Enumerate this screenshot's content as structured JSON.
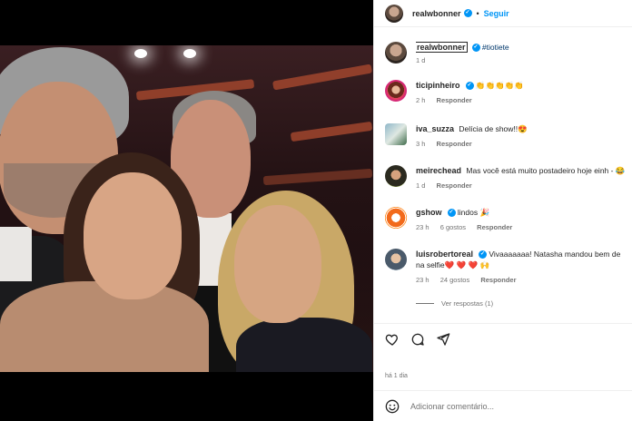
{
  "post": {
    "author": "realwbonner",
    "follow_label": "Seguir",
    "dot": "•",
    "caption": {
      "username": "realwbonner",
      "hashtag": "#tiotiete",
      "time": "1 d"
    },
    "photo_alt": "Selfie de quatro pessoas em estúdio de TV"
  },
  "comments": [
    {
      "username": "ticipinheiro",
      "verified": true,
      "text": "👏👏👏👏👏",
      "time": "2 h",
      "likes": "",
      "reply": "Responder",
      "avatar_icon": "tici-avatar"
    },
    {
      "username": "iva_suzza",
      "verified": false,
      "text": "Delícia de show!!😍",
      "time": "3 h",
      "likes": "",
      "reply": "Responder",
      "avatar_icon": "iva-avatar"
    },
    {
      "username": "meirechead",
      "verified": false,
      "text": "Mas você está muito postadeiro hoje einh - 😂",
      "time": "1 d",
      "likes": "",
      "reply": "Responder",
      "avatar_icon": "meire-avatar"
    },
    {
      "username": "gshow",
      "verified": true,
      "text": "lindos 🎉",
      "time": "23 h",
      "likes": "6 gostos",
      "reply": "Responder",
      "avatar_icon": "gshow-avatar"
    },
    {
      "username": "luisrobertoreal",
      "verified": true,
      "text": "Vivaaaaaaa! Natasha mandou bem de",
      "text2": "na selfie❤️ ❤️ ❤️ 🙌",
      "time": "23 h",
      "likes": "24 gostos",
      "reply": "Responder",
      "avatar_icon": "luis-avatar"
    }
  ],
  "view_replies": "Ver respostas (1)",
  "posted_ago": "há 1 dia",
  "add_comment": {
    "placeholder": "Adicionar comentário..."
  },
  "colors": {
    "link": "#0095f6",
    "text": "#262626",
    "muted": "#737373",
    "hashtag": "#00376b"
  }
}
